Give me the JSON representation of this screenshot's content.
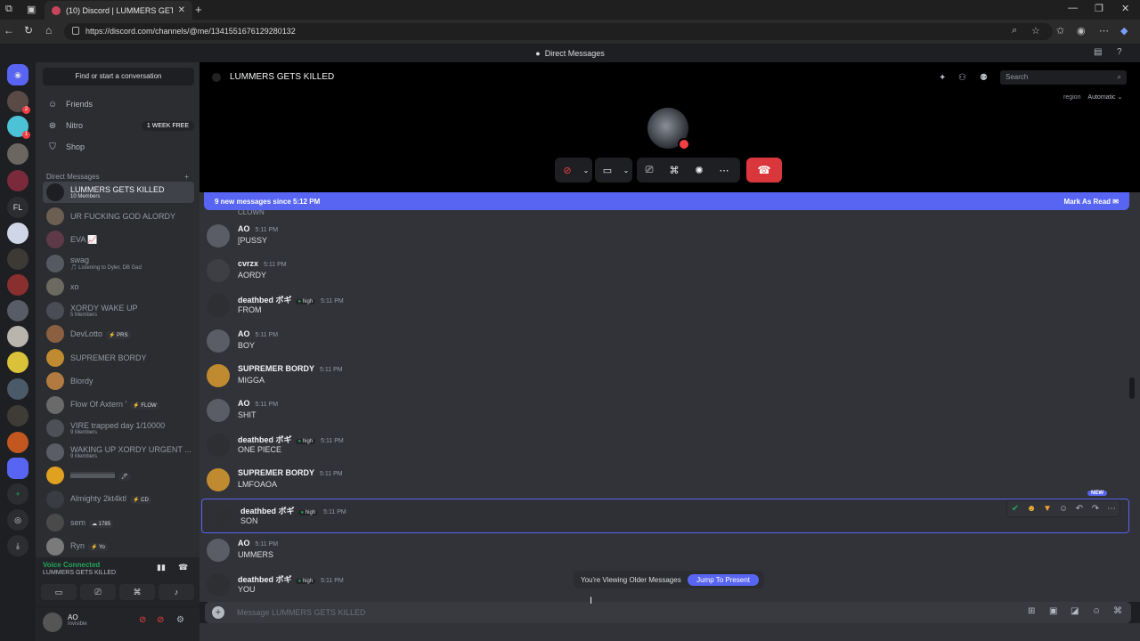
{
  "browser": {
    "tab_title": "(10) Discord | LUMMERS GETS KILLED",
    "url": "https://discord.com/channels/@me/1341551676129280132",
    "icons": [
      "back-icon",
      "refresh-icon",
      "home-icon",
      "zoom-icon",
      "favorite-icon",
      "collections-icon",
      "profile-icon",
      "more-icon",
      "copilot-icon"
    ]
  },
  "titlebar": {
    "title": "Direct Messages"
  },
  "guilds": {
    "folder_label": "FL",
    "badges": [
      "2",
      "9",
      "1"
    ]
  },
  "sidebar": {
    "search_label": "Find or start a conversation",
    "nav": [
      {
        "label": "Friends",
        "icon": "friends-icon"
      },
      {
        "label": "Nitro",
        "icon": "nitro-icon",
        "badge": "1 WEEK FREE"
      },
      {
        "label": "Shop",
        "icon": "shop-icon"
      }
    ],
    "dm_header": "Direct Messages",
    "dm_add": "+",
    "dms": [
      {
        "name": "LUMMERS GETS KILLED",
        "sub": "10 Members",
        "active": true
      },
      {
        "name": "UR FUCKING GOD ALORDY",
        "sub": ""
      },
      {
        "name": "EVA 📈",
        "sub": ""
      },
      {
        "name": "swag",
        "sub": "🎵 Listening to Dyler, DB Gad"
      },
      {
        "name": "xo",
        "sub": ""
      },
      {
        "name": "XORDY WAKE UP",
        "sub": "5 Members"
      },
      {
        "name": "DevLotto",
        "sub": "",
        "tag": "⚡ PRS"
      },
      {
        "name": "SUPREMER BORDY",
        "sub": ""
      },
      {
        "name": "Blordy",
        "sub": ""
      },
      {
        "name": "Flow Of Axtern '",
        "sub": "",
        "tag": "⚡ FLOW"
      },
      {
        "name": "VIRE trapped day 1/10000",
        "sub": "9 Members"
      },
      {
        "name": "WAKING UP XORDY URGENT ...",
        "sub": "9 Members"
      },
      {
        "name": "iiiiiiiiiiiiiiiiiiiiiiiii",
        "sub": "",
        "tag": "🖊"
      },
      {
        "name": "Almighty 2kt4ktl",
        "sub": "",
        "tag": "⚡ CD"
      },
      {
        "name": "sem",
        "sub": "",
        "tag": "☁ 1785"
      },
      {
        "name": "Ryn",
        "sub": "",
        "tag": "⚡ Yo"
      }
    ]
  },
  "voice": {
    "status": "Voice Connected",
    "channel": "LUMMERS GETS KILLED"
  },
  "user": {
    "name": "AO",
    "status": "Invisible"
  },
  "call": {
    "title": "LUMMERS GETS KILLED",
    "search_placeholder": "Search",
    "region_label": "region",
    "region_value": "Automatic ⌄"
  },
  "chat": {
    "new_messages": "9 new messages since 5:12 PM",
    "mark_read": "Mark As Read",
    "clipped_text": "CLOWN",
    "messages": [
      {
        "author": "AO",
        "time": "5:11 PM",
        "text": "[PUSSY",
        "badge": ""
      },
      {
        "author": "cvrzx",
        "time": "5:11 PM",
        "text": "AORDY",
        "badge": ""
      },
      {
        "author": "deathbed ボギ",
        "time": "5:11 PM",
        "text": "FROM",
        "badge": "high"
      },
      {
        "author": "AO",
        "time": "5:11 PM",
        "text": "BOY",
        "badge": ""
      },
      {
        "author": "SUPREMER BORDY",
        "time": "5:11 PM",
        "text": "MIGGA",
        "badge": ""
      },
      {
        "author": "AO",
        "time": "5:11 PM",
        "text": "SHIT",
        "badge": ""
      },
      {
        "author": "deathbed ボギ",
        "time": "5:11 PM",
        "text": "ONE PIECE",
        "badge": "high"
      },
      {
        "author": "SUPREMER BORDY",
        "time": "5:11 PM",
        "text": "LMFOAOA",
        "badge": ""
      },
      {
        "author": "deathbed ボギ",
        "time": "5:11 PM",
        "text": "SON",
        "badge": "high",
        "highlight": true
      },
      {
        "author": "AO",
        "time": "5:11 PM",
        "text": "UMMERS",
        "badge": ""
      },
      {
        "author": "deathbed ボギ",
        "time": "5:11 PM",
        "text": "YOU",
        "badge": "high"
      }
    ],
    "new_tag": "NEW",
    "viewing_older": "You're Viewing Older Messages",
    "jump_present": "Jump To Present",
    "composer_placeholder": "Message LUMMERS GETS KILLED"
  }
}
